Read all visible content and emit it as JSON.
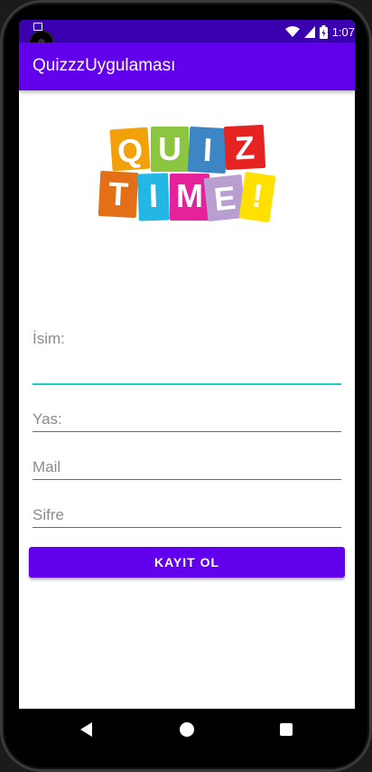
{
  "status_bar": {
    "time": "1:07"
  },
  "app_bar": {
    "title": "QuizzzUygulaması"
  },
  "logo": {
    "line1": [
      "Q",
      "U",
      "I",
      "Z"
    ],
    "line2": [
      "T",
      "I",
      "M",
      "E",
      "!"
    ]
  },
  "form": {
    "name_label": "İsim:",
    "name_value": "",
    "age_placeholder": "Yas:",
    "mail_placeholder": "Mail",
    "password_placeholder": "Sifre"
  },
  "register_button": {
    "label": "KAYIT OL"
  },
  "colors": {
    "accent": "#6200ee",
    "status_bar": "#3a00b0",
    "focus_underline": "#1ad1c6"
  },
  "icons": {
    "nav": [
      "back-icon",
      "home-icon",
      "recent-apps-icon"
    ],
    "status": [
      "sim-card-icon",
      "wifi-icon",
      "cell-signal-icon",
      "battery-icon"
    ]
  }
}
